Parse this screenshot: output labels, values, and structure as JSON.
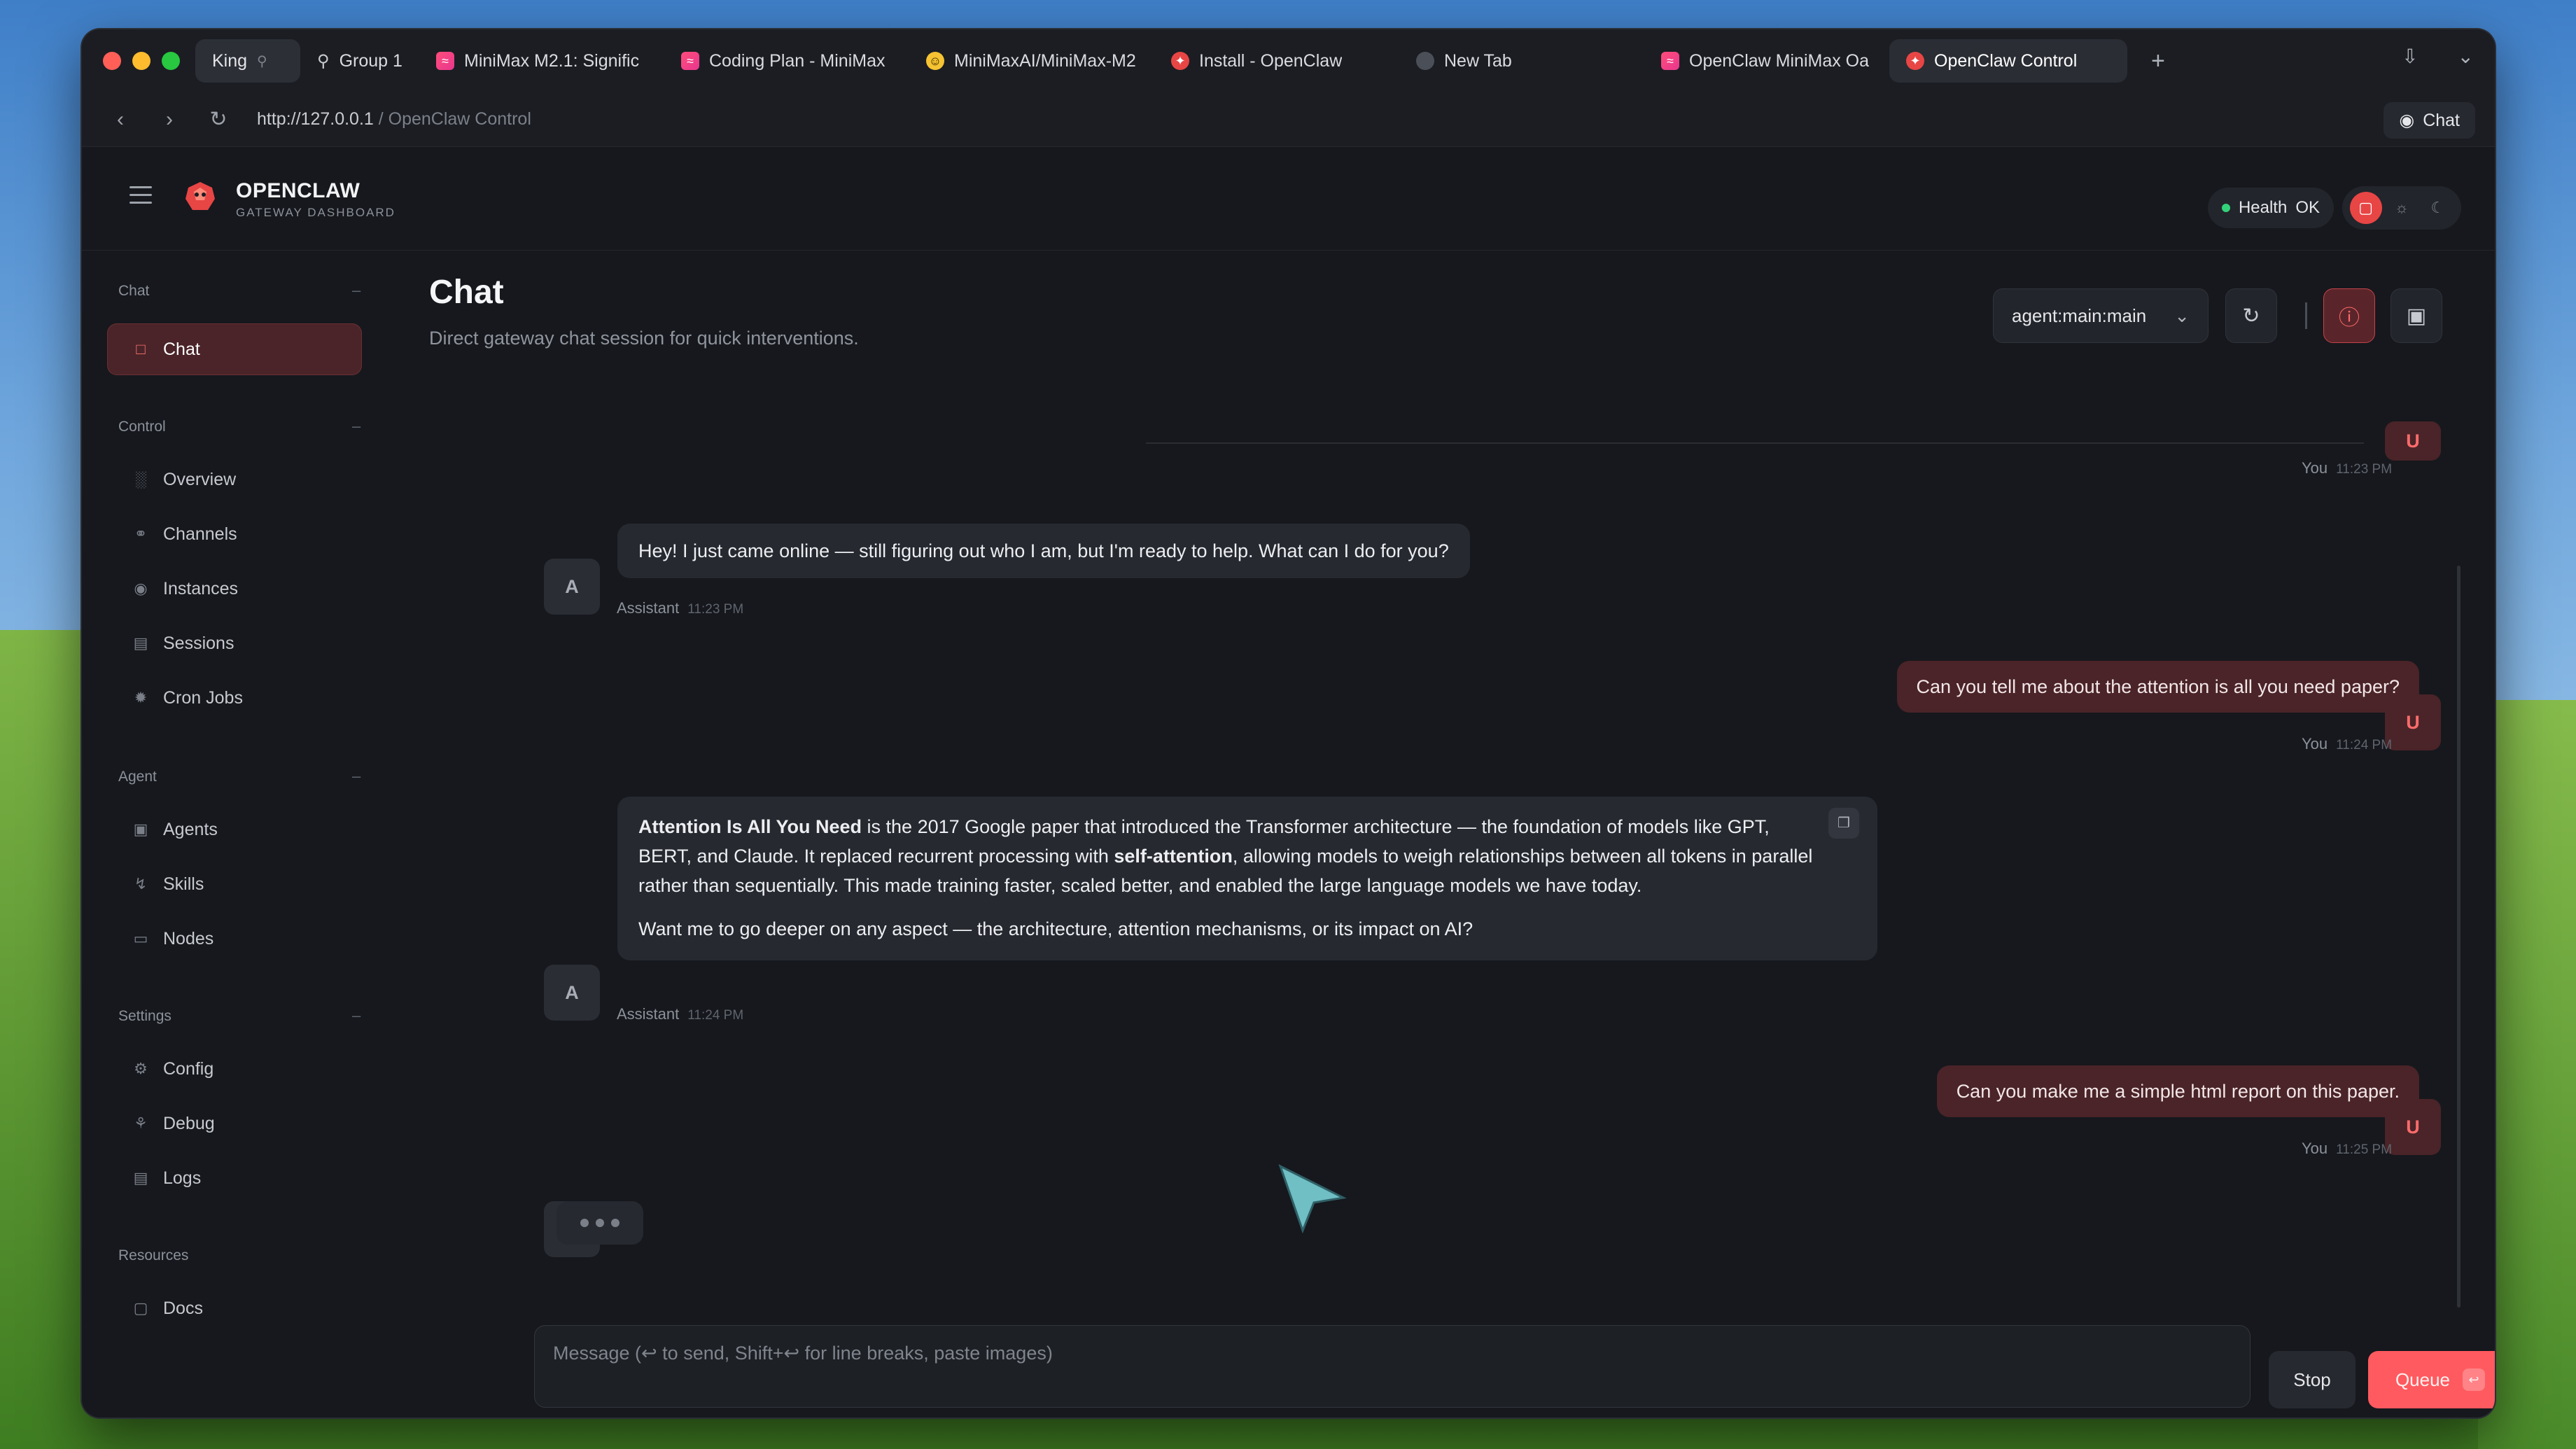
{
  "browser": {
    "tabs": [
      {
        "label": "King",
        "kind": "group"
      },
      {
        "label": "Group 1",
        "kind": "search"
      },
      {
        "label": "MiniMax M2.1: Signific",
        "kind": "mm"
      },
      {
        "label": "Coding Plan - MiniMax",
        "kind": "mm"
      },
      {
        "label": "MiniMaxAI/MiniMax-M2",
        "kind": "hf"
      },
      {
        "label": "Install - OpenClaw",
        "kind": "oc"
      },
      {
        "label": "New Tab",
        "kind": "nt"
      },
      {
        "label": "OpenClaw MiniMax Oa",
        "kind": "mm"
      },
      {
        "label": "OpenClaw Control",
        "kind": "oc",
        "active": true
      }
    ],
    "url_host": "http://127.0.0.1",
    "url_path": " / OpenClaw Control",
    "chat_pill": "Chat"
  },
  "app": {
    "brand_name": "OPENCLAW",
    "brand_sub": "GATEWAY DASHBOARD",
    "health_label": "Health",
    "health_value": "OK",
    "accent": "#e84545"
  },
  "sidebar": {
    "sections": [
      {
        "title": "Chat",
        "items": [
          {
            "label": "Chat",
            "icon": "chat-icon",
            "active": true
          }
        ]
      },
      {
        "title": "Control",
        "items": [
          {
            "label": "Overview",
            "icon": "bar-chart-icon"
          },
          {
            "label": "Channels",
            "icon": "link-icon"
          },
          {
            "label": "Instances",
            "icon": "broadcast-icon"
          },
          {
            "label": "Sessions",
            "icon": "document-icon"
          },
          {
            "label": "Cron Jobs",
            "icon": "loader-icon"
          }
        ]
      },
      {
        "title": "Agent",
        "items": [
          {
            "label": "Agents",
            "icon": "folder-icon"
          },
          {
            "label": "Skills",
            "icon": "lightning-icon"
          },
          {
            "label": "Nodes",
            "icon": "monitor-icon"
          }
        ]
      },
      {
        "title": "Settings",
        "items": [
          {
            "label": "Config",
            "icon": "gear-icon"
          },
          {
            "label": "Debug",
            "icon": "bug-icon"
          },
          {
            "label": "Logs",
            "icon": "scroll-icon"
          }
        ]
      },
      {
        "title": "Resources",
        "items": [
          {
            "label": "Docs",
            "icon": "book-icon"
          }
        ]
      }
    ]
  },
  "main": {
    "title": "Chat",
    "subtitle": "Direct gateway chat session for quick interventions.",
    "session": "agent:main:main",
    "messages": [
      {
        "role": "user",
        "meta_name": "You",
        "time": "11:23 PM",
        "text": ""
      },
      {
        "role": "assistant",
        "meta_name": "Assistant",
        "time": "11:23 PM",
        "text": "Hey! I just came online — still figuring out who I am, but I'm ready to help. What can I do for you?"
      },
      {
        "role": "user",
        "meta_name": "You",
        "time": "11:24 PM",
        "text": "Can you tell me about the attention is all you need paper?"
      },
      {
        "role": "assistant",
        "meta_name": "Assistant",
        "time": "11:24 PM",
        "bold_lead": "Attention Is All You Need",
        "p1_a": " is the 2017 Google paper that introduced the Transformer architecture — the foundation of models like GPT, BERT, and Claude. It replaced recurrent processing with ",
        "p1_bold": "self-attention",
        "p1_b": ", allowing models to weigh relationships between all tokens in parallel rather than sequentially. This made training faster, scaled better, and enabled the large language models we have today.",
        "p2": "Want me to go deeper on any aspect — the architecture, attention mechanisms, or its impact on AI?"
      },
      {
        "role": "user",
        "meta_name": "You",
        "time": "11:25 PM",
        "text": "Can you make me a simple html report on this paper."
      }
    ],
    "avatar_assistant": "A",
    "avatar_user": "U",
    "composer_placeholder": "Message (↩ to send, Shift+↩ for line breaks, paste images)",
    "stop_label": "Stop",
    "queue_label": "Queue"
  }
}
